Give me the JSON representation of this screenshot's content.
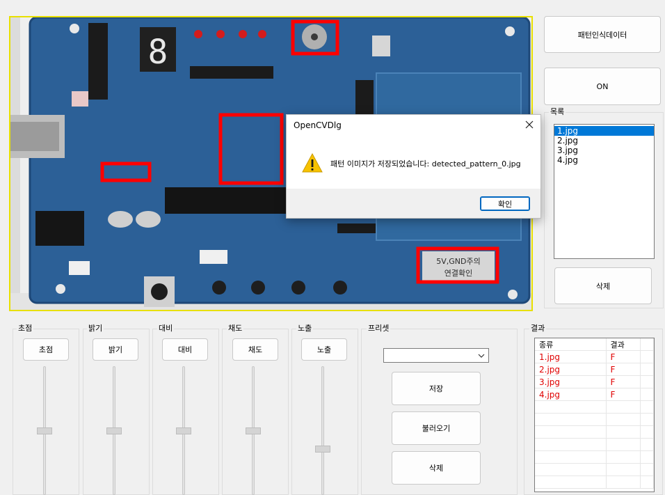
{
  "buttons": {
    "pattern_data": "패턴인식데이터",
    "on": "ON",
    "list_delete": "삭제"
  },
  "file_list": {
    "label": "목록",
    "items": [
      "1.jpg",
      "2.jpg",
      "3.jpg",
      "4.jpg"
    ],
    "selected_index": 0
  },
  "adjust_groups": [
    {
      "label": "초점",
      "button": "초점",
      "slider_level": 0.5
    },
    {
      "label": "밝기",
      "button": "밝기",
      "slider_level": 0.5
    },
    {
      "label": "대비",
      "button": "대비",
      "slider_level": 0.5
    },
    {
      "label": "채도",
      "button": "채도",
      "slider_level": 0.5
    },
    {
      "label": "노출",
      "button": "노출",
      "slider_level": 0.35
    }
  ],
  "preset": {
    "label": "프리셋",
    "selected": "",
    "save": "저장",
    "load": "불러오기",
    "delete": "삭제"
  },
  "results": {
    "label": "결과",
    "headers": [
      "종류",
      "결과"
    ],
    "rows": [
      {
        "name": "1.jpg",
        "result": "F"
      },
      {
        "name": "2.jpg",
        "result": "F"
      },
      {
        "name": "3.jpg",
        "result": "F"
      },
      {
        "name": "4.jpg",
        "result": "F"
      }
    ]
  },
  "dialog": {
    "title": "OpenCVDlg",
    "message": "패턴 이미지가 저장되었습니다: detected_pattern_0.jpg",
    "ok": "확인",
    "icon": "warning-icon"
  },
  "preview": {
    "board_labels": [
      "5V,GND주의",
      "연결확인"
    ],
    "seven_seg": "8",
    "highlight_color": "#ff0000"
  },
  "colors": {
    "board_blue": "#2b5f96",
    "preview_border": "#e8e000",
    "result_fail": "#e00000",
    "selection": "#0078d7"
  }
}
